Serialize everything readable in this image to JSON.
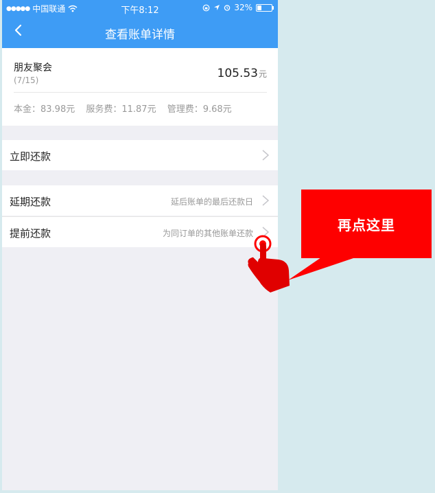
{
  "status_bar": {
    "signal_dots": "●●●●●",
    "carrier": "中国联通",
    "time": "下午8:12",
    "battery_percent": "32%",
    "battery_level": 0.32
  },
  "nav": {
    "title": "查看账单详情"
  },
  "bill": {
    "name": "朋友聚会",
    "date": "(7/15)",
    "amount": "105.53",
    "unit": "元",
    "principal": "本金：83.98元",
    "service_fee": "服务费：11.87元",
    "management_fee": "管理费：9.68元"
  },
  "actions": {
    "pay_now": {
      "label": "立即还款"
    },
    "defer": {
      "label": "延期还款",
      "hint": "延后账单的最后还款日"
    },
    "prepay": {
      "label": "提前还款",
      "hint": "为同订单的其他账单还款"
    }
  },
  "annotation": {
    "callout_text": "再点这里",
    "colors": {
      "accent": "#fe0000"
    }
  },
  "colors": {
    "brand_blue": "#3e9cf5",
    "page_bg": "#efeff4",
    "outer_bg": "#d6eaee"
  }
}
